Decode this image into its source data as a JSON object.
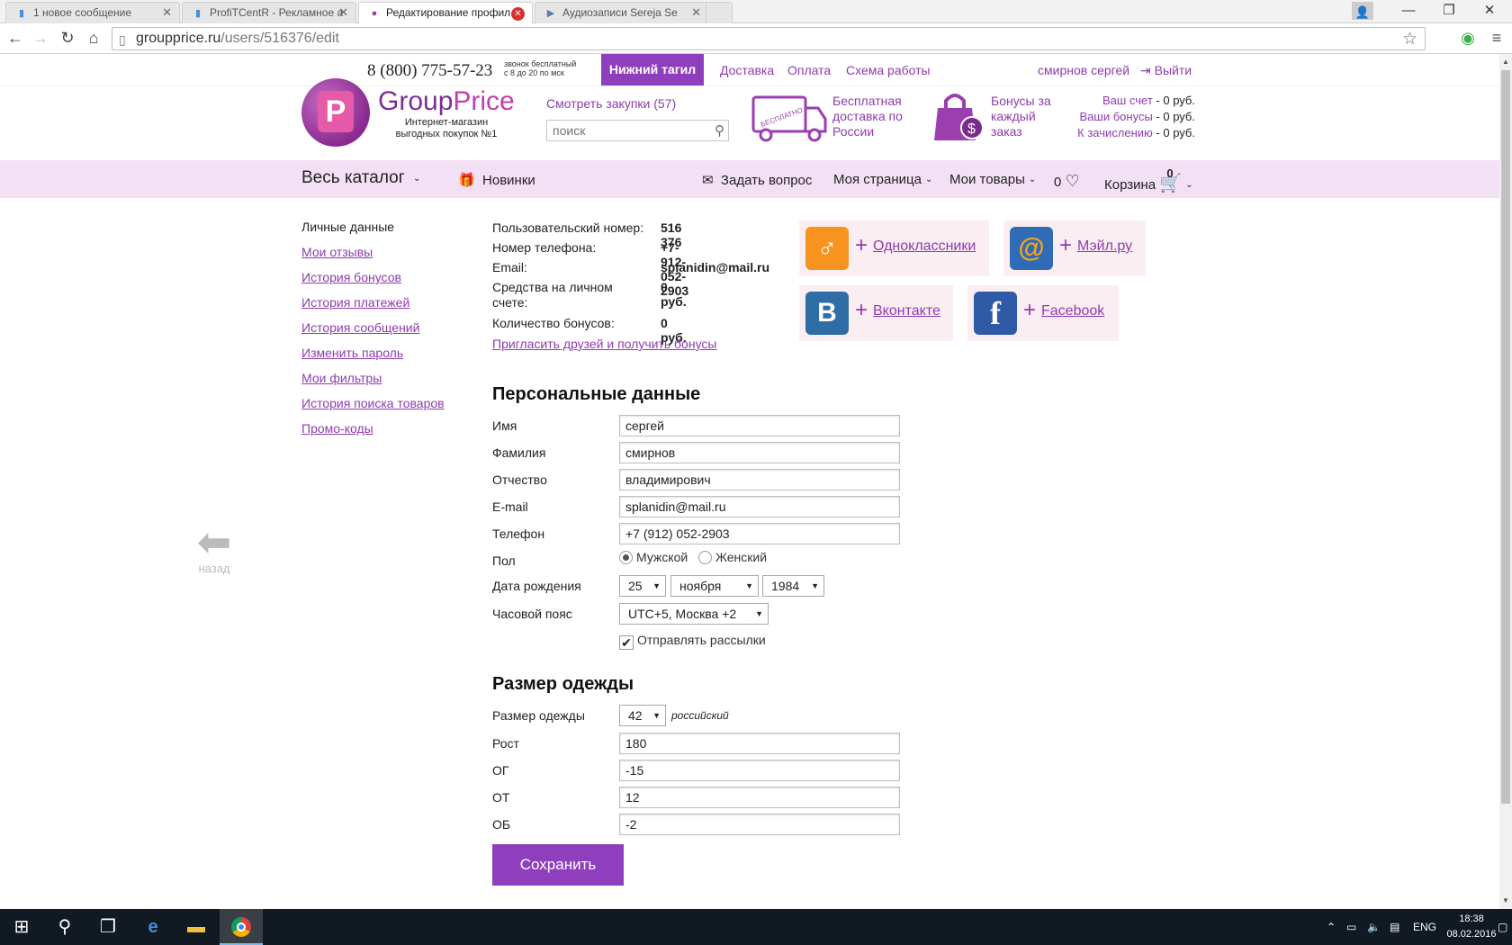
{
  "browser": {
    "tabs": [
      {
        "title": "1 новое сообщение"
      },
      {
        "title": "ProfiTCentR - Рекламное а"
      },
      {
        "title": "Редактирование профил"
      },
      {
        "title": "Аудиозаписи Sereja Se"
      }
    ],
    "url_host": "groupprice.ru",
    "url_path": "/users/516376/edit"
  },
  "topbar": {
    "phone": "8 (800) 775-57-23",
    "phone_note_1": "звонок бесплатный",
    "phone_note_2": "с 8 до 20 по мск",
    "city": "Нижний тагил",
    "links": [
      "Доставка",
      "Оплата",
      "Схема работы"
    ],
    "user": "смирнов сергей",
    "logout": "Выйти"
  },
  "header": {
    "brand_group": "Group",
    "brand_price": "Price",
    "tagline_1": "Интернет-магазин",
    "tagline_2": "выгодных покупок №1",
    "purchases": "Смотреть закупки (57)",
    "search_placeholder": "поиск",
    "delivery_1": "Бесплатная",
    "delivery_2": "доставка по",
    "delivery_3": "России",
    "truck_badge": "БЕСПЛАТНО",
    "bonus_1": "Бонусы за",
    "bonus_2": "каждый",
    "bonus_3": "заказ",
    "account": [
      {
        "label": "Ваш счет",
        "value": "- 0 руб."
      },
      {
        "label": "Ваши бонусы",
        "value": "- 0 руб."
      },
      {
        "label": "К зачислению",
        "value": "- 0 руб."
      }
    ]
  },
  "nav": {
    "catalog": "Весь каталог",
    "new": "Новинки",
    "ask": "Задать вопрос",
    "mypage": "Моя страница",
    "mygoods": "Мои товары",
    "fav_count": "0",
    "cart": "Корзина",
    "cart_count": "0"
  },
  "sidebar": {
    "items": [
      {
        "label": "Личные данные"
      },
      {
        "label": "Мои отзывы"
      },
      {
        "label": "История бонусов"
      },
      {
        "label": "История платежей"
      },
      {
        "label": "История сообщений"
      },
      {
        "label": "Изменить пароль"
      },
      {
        "label": "Мои фильтры"
      },
      {
        "label": "История поиска товаров"
      },
      {
        "label": "Промо-коды"
      }
    ],
    "back": "назад"
  },
  "info": {
    "rows": [
      {
        "key": "Пользовательский номер:",
        "value": "516 376"
      },
      {
        "key": "Номер телефона:",
        "value": "+7-912-052-2903"
      },
      {
        "key": "Email:",
        "value": "splanidin@mail.ru"
      },
      {
        "key": "Средства на личном счете:",
        "value": "0 руб."
      },
      {
        "key": "Количество бонусов:",
        "value": "0 руб."
      }
    ],
    "invite": "Пригласить друзей и получить бонусы"
  },
  "social": [
    {
      "name": "Одноклассники",
      "glyph": "ok",
      "color": "#f7931e"
    },
    {
      "name": "Мэйл.ру",
      "glyph": "@",
      "color": "#2f6cb5"
    },
    {
      "name": "Вконтакте",
      "glyph": "B",
      "color": "#2f6da6"
    },
    {
      "name": "Facebook",
      "glyph": "f",
      "color": "#2f5aa6"
    }
  ],
  "personal": {
    "title": "Персональные данные",
    "first_name_label": "Имя",
    "first_name": "сергей",
    "last_name_label": "Фамилия",
    "last_name": "смирнов",
    "patronymic_label": "Отчество",
    "patronymic": "владимирович",
    "email_label": "E-mail",
    "email": "splanidin@mail.ru",
    "phone_label": "Телефон",
    "phone": "+7 (912) 052-2903",
    "gender_label": "Пол",
    "gender_male": "Мужской",
    "gender_female": "Женский",
    "gender_selected": "male",
    "birth_label": "Дата рождения",
    "birth_day": "25",
    "birth_month": "ноября",
    "birth_year": "1984",
    "tz_label": "Часовой пояс",
    "tz": "UTC+5, Москва +2",
    "newsletter": "Отправлять рассылки",
    "newsletter_checked": true
  },
  "clothing": {
    "title": "Размер одежды",
    "size_label": "Размер одежды",
    "size": "42",
    "size_note": "российский",
    "height_label": "Рост",
    "height": "180",
    "og_label": "ОГ",
    "og": "-15",
    "ot_label": "ОТ",
    "ot": "12",
    "ob_label": "ОБ",
    "ob": "-2"
  },
  "save": "Сохранить",
  "taskbar": {
    "lang": "ENG",
    "time": "18:38",
    "date": "08.02.2016"
  },
  "colors": {
    "accent": "#8f3fbd",
    "nav_bg": "#f3e0f4",
    "link": "#8e3bb0"
  }
}
